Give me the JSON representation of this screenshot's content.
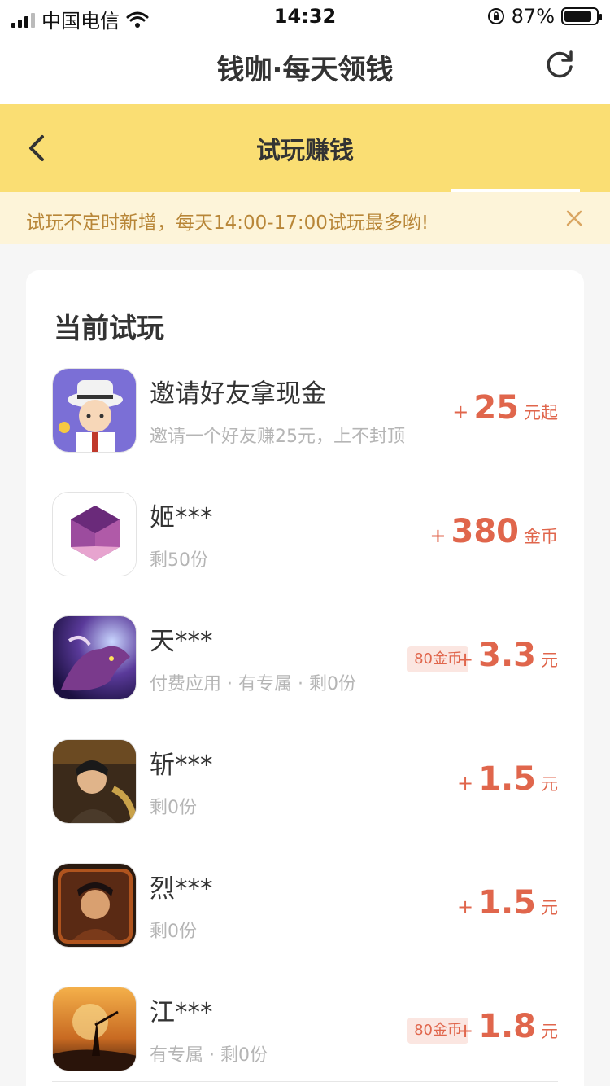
{
  "status_bar": {
    "carrier": "中国电信",
    "time": "14:32",
    "battery": "87%",
    "battery_level": 0.87
  },
  "top_bar": {
    "title": "钱咖·每天领钱"
  },
  "sub_header": {
    "title": "试玩赚钱"
  },
  "notice": {
    "text": "试玩不定时新增，每天14:00-17:00试玩最多哟!"
  },
  "section": {
    "title": "当前试玩"
  },
  "items": [
    {
      "name": "邀请好友拿现金",
      "sub": "邀请一个好友赚25元，上不封顶",
      "plus": "+",
      "amount": "25",
      "unit": "元起",
      "badge": ""
    },
    {
      "name": "姬***",
      "sub": "剩50份",
      "plus": "+",
      "amount": "380",
      "unit": "金币",
      "badge": ""
    },
    {
      "name": "天***",
      "sub": "付费应用 · 有专属 · 剩0份",
      "plus": "+",
      "amount": "3.3",
      "unit": "元",
      "badge": "80金币"
    },
    {
      "name": "斩***",
      "sub": "剩0份",
      "plus": "+",
      "amount": "1.5",
      "unit": "元",
      "badge": ""
    },
    {
      "name": "烈***",
      "sub": "剩0份",
      "plus": "+",
      "amount": "1.5",
      "unit": "元",
      "badge": ""
    },
    {
      "name": "江***",
      "sub": "有专属 · 剩0份",
      "plus": "+",
      "amount": "1.8",
      "unit": "元",
      "badge": "80金币"
    }
  ],
  "colors": {
    "accent": "#e0664c",
    "header_yellow": "#fade73",
    "notice_bg": "#fdf4d9",
    "notice_text": "#b88638"
  }
}
